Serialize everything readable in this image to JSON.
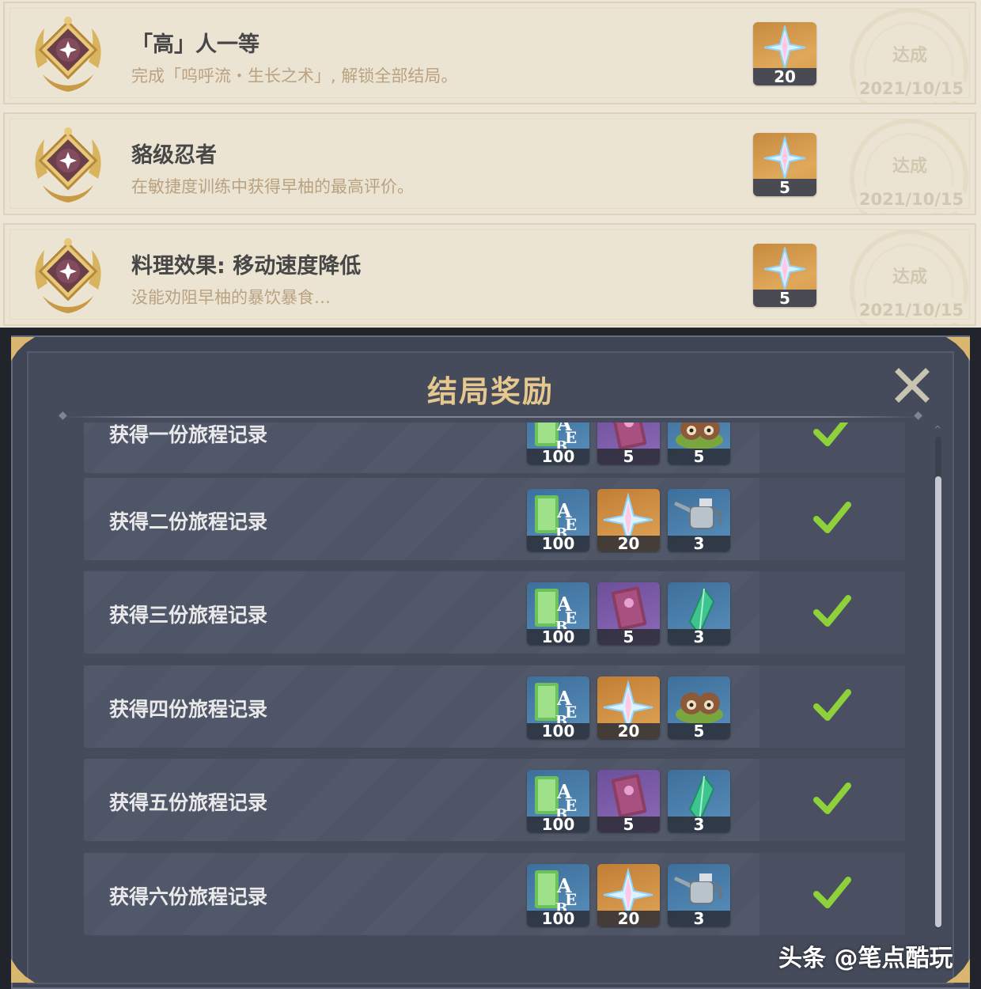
{
  "achievements": [
    {
      "title": "「高」人一等",
      "description": "完成「呜呼流・生长之术」, 解锁全部结局。",
      "reward_count": "20",
      "status": "达成",
      "date": "2021/10/15"
    },
    {
      "title": "貉级忍者",
      "description": "在敏捷度训练中获得早柚的最高评价。",
      "reward_count": "5",
      "status": "达成",
      "date": "2021/10/15"
    },
    {
      "title": "料理效果: 移动速度降低",
      "description": "没能劝阻早柚的暴饮暴食…",
      "reward_count": "5",
      "status": "达成",
      "date": "2021/10/15"
    }
  ],
  "dialog": {
    "title": "结局奖励",
    "close_icon": "close-icon",
    "rows": [
      {
        "label": "获得一份旅程记录",
        "rewards": [
          {
            "icon": "adventure-exp-icon",
            "count": "100"
          },
          {
            "icon": "purple-book-icon",
            "count": "5"
          },
          {
            "icon": "tanuki-food-icon",
            "count": "5"
          }
        ],
        "completed": true
      },
      {
        "label": "获得二份旅程记录",
        "rewards": [
          {
            "icon": "adventure-exp-icon",
            "count": "100"
          },
          {
            "icon": "primogem-icon",
            "count": "20"
          },
          {
            "icon": "watering-can-icon",
            "count": "3"
          }
        ],
        "completed": true
      },
      {
        "label": "获得三份旅程记录",
        "rewards": [
          {
            "icon": "adventure-exp-icon",
            "count": "100"
          },
          {
            "icon": "purple-book-icon",
            "count": "5"
          },
          {
            "icon": "green-crystal-icon",
            "count": "3"
          }
        ],
        "completed": true
      },
      {
        "label": "获得四份旅程记录",
        "rewards": [
          {
            "icon": "adventure-exp-icon",
            "count": "100"
          },
          {
            "icon": "primogem-icon",
            "count": "20"
          },
          {
            "icon": "tanuki-food-icon",
            "count": "5"
          }
        ],
        "completed": true
      },
      {
        "label": "获得五份旅程记录",
        "rewards": [
          {
            "icon": "adventure-exp-icon",
            "count": "100"
          },
          {
            "icon": "purple-book-icon",
            "count": "5"
          },
          {
            "icon": "green-crystal-icon",
            "count": "3"
          }
        ],
        "completed": true
      },
      {
        "label": "获得六份旅程记录",
        "rewards": [
          {
            "icon": "adventure-exp-icon",
            "count": "100"
          },
          {
            "icon": "primogem-icon",
            "count": "20"
          },
          {
            "icon": "watering-can-icon",
            "count": "3"
          }
        ],
        "completed": true
      }
    ]
  },
  "watermark": "头条 @笔点酷玩",
  "colors": {
    "title_gold": "#e6c88e",
    "check_green": "#8ed13a",
    "card_bg": "#ece4d3",
    "dialog_bg": "#454b5b"
  }
}
